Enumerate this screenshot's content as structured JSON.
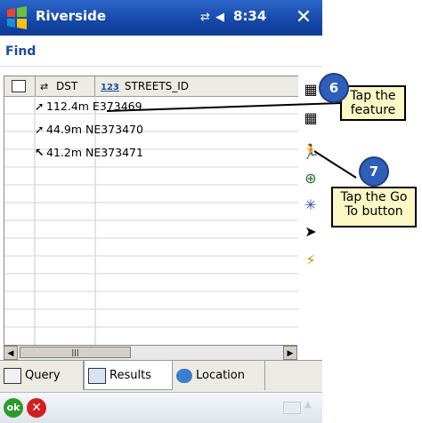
{
  "titlebar": {
    "app_title": "Riverside",
    "status_icons": "⇄ ◀︎",
    "clock": "8:34",
    "close_glyph": "✕"
  },
  "menu": {
    "find_label": "Find"
  },
  "grid": {
    "headers": [
      {
        "label": ""
      },
      {
        "label": "DST"
      },
      {
        "label": "STREETS_ID",
        "type_badge": "123"
      }
    ],
    "rows": [
      {
        "arrow": "➚",
        "text": "112.4m E373469"
      },
      {
        "arrow": "➚",
        "text": "44.9m NE373470"
      },
      {
        "arrow": "↖",
        "text": "41.2m NE373471"
      }
    ]
  },
  "scrollbar": {
    "left": "◀",
    "right": "▶",
    "thumb": "|||"
  },
  "tabs": [
    {
      "label": "Query",
      "active": false
    },
    {
      "label": "Results",
      "active": true
    },
    {
      "label": "Location",
      "active": false
    }
  ],
  "bottombar": {
    "ok_label": "ok",
    "cancel_glyph": "✕"
  },
  "tools": [
    {
      "name": "list-tool-icon",
      "glyph": "▦"
    },
    {
      "name": "table-tool-icon",
      "glyph": "▦"
    },
    {
      "name": "go-to-icon",
      "glyph": "🏃"
    },
    {
      "name": "zoom-feature-icon",
      "glyph": "⊕"
    },
    {
      "name": "flash-feature-icon",
      "glyph": "✳"
    },
    {
      "name": "select-pointer-icon",
      "glyph": "➤"
    },
    {
      "name": "lightning-icon",
      "glyph": "⚡"
    }
  ],
  "callouts": [
    {
      "badge": "6",
      "text_line1": "Tap the",
      "text_line2": "feature"
    },
    {
      "badge": "7",
      "text_line1": "Tap the Go",
      "text_line2": "To button"
    }
  ],
  "colors": {
    "title_bar": "#1447a8",
    "accent_text": "#1b4aa1",
    "callout_bg": "#fbf8c6",
    "badge": "#2f5fb9"
  }
}
